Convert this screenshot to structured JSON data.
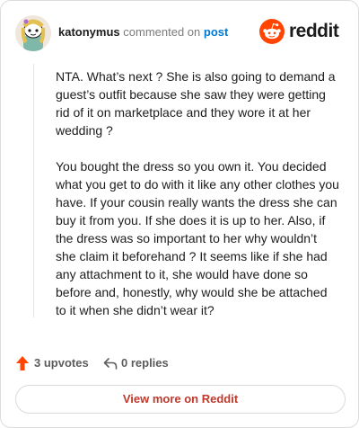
{
  "header": {
    "username": "katonymus",
    "action_text": "commented on",
    "post_link": "post",
    "brand_name": "reddit",
    "avatar_icon": "snoo-avatar-icon",
    "brand_icon": "reddit-snoo-icon"
  },
  "comment": {
    "paragraphs": [
      "NTA. What’s next ? She is also going to demand a guest’s outfit because she saw they were getting rid of it on marketplace and they wore it at her wedding ?",
      "You bought the dress so you own it. You decided what you get to do with it like any other clothes you have. If your cousin really wants the dress she can buy it from you. If she does it is up to her. Also, if the dress was so important to her why wouldn’t she claim it beforehand ? It seems like if she had any attachment to it, she would have done so before and, honestly, why would she be attached to it when she didn’t wear it?"
    ]
  },
  "stats": {
    "upvotes_label": "3 upvotes",
    "replies_label": "0 replies",
    "upvote_icon": "upvote-arrow-icon",
    "reply_icon": "reply-arrow-icon"
  },
  "footer": {
    "view_more_label": "View more on Reddit"
  },
  "colors": {
    "accent": "#ff4500",
    "link": "#0079d3",
    "muted": "#7c7c7c"
  }
}
